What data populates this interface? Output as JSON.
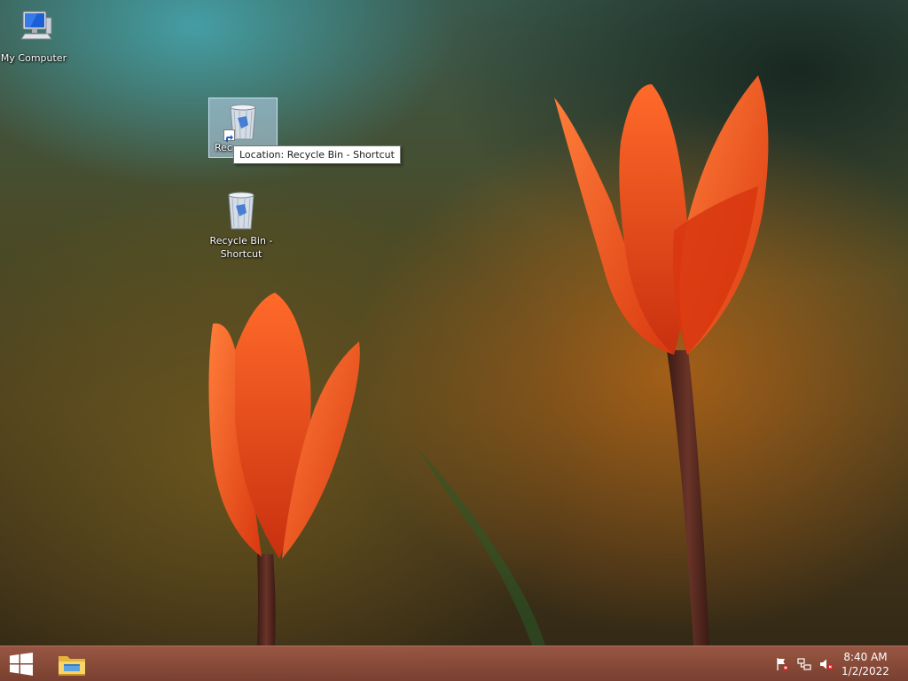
{
  "desktop": {
    "icons": [
      {
        "label": "My Computer",
        "icon": "computer-icon"
      },
      {
        "label": "Rec",
        "icon": "recycle-bin-icon",
        "shortcut": true,
        "selected": true
      },
      {
        "label": "Recycle Bin - Shortcut",
        "icon": "recycle-bin-icon"
      }
    ],
    "tooltip": "Location: Recycle Bin - Shortcut"
  },
  "taskbar": {
    "start_icon": "windows-logo-icon",
    "pinned": [
      {
        "icon": "file-explorer-icon"
      }
    ],
    "tray": [
      "action-center-flag-icon",
      "network-icon",
      "volume-muted-icon"
    ],
    "time": "8:40 AM",
    "date": "1/2/2022"
  },
  "colors": {
    "taskbar": "#8f4f3e",
    "tulip": "#e8481c",
    "tooltip_bg": "#ffffff"
  }
}
